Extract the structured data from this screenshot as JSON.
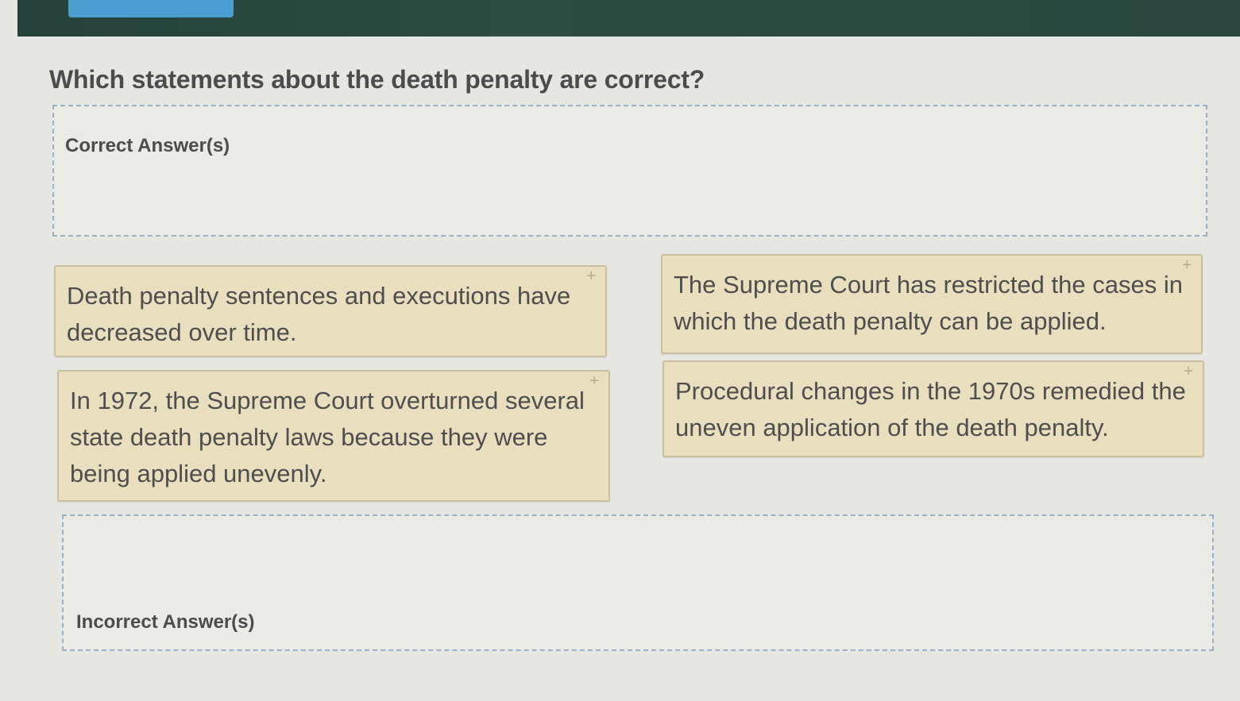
{
  "question": "Which statements about the death penalty are correct?",
  "zones": {
    "correct_label": "Correct Answer(s)",
    "incorrect_label": "Incorrect Answer(s)"
  },
  "cards": [
    {
      "text": "Death penalty sentences and executions have decreased over time.",
      "icon": "+"
    },
    {
      "text": "The Supreme Court has restricted the cases in which the death penalty can be applied.",
      "icon": "+"
    },
    {
      "text": "In 1972, the Supreme Court overturned several state death penalty laws because they were being applied unevenly.",
      "icon": "+"
    },
    {
      "text": "Procedural changes in the 1970s remedied the uneven application of the death penalty.",
      "icon": "+"
    }
  ],
  "colors": {
    "header": "#2a483f",
    "tab": "#4a9fd0",
    "card": "#e9dfbf",
    "dashed_border": "#9cb0c4"
  }
}
